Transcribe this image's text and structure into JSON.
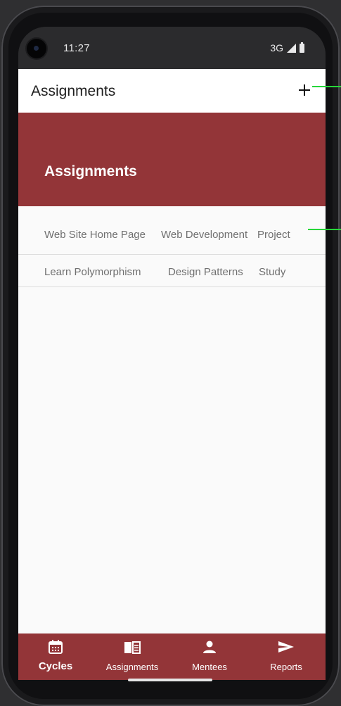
{
  "status_bar": {
    "time": "11:27",
    "network": "3G"
  },
  "top_bar": {
    "title": "Assignments",
    "add_icon": "plus-icon"
  },
  "banner": {
    "title": "Assignments"
  },
  "assignments": [
    {
      "name": "Web Site Home Page",
      "course": "Web Development",
      "type": "Project"
    },
    {
      "name": "Learn Polymorphism",
      "course": "Design Patterns",
      "type": "Study"
    }
  ],
  "bottom_nav": {
    "active": "Cycles",
    "items": [
      {
        "label": "Cycles",
        "icon": "calendar-icon"
      },
      {
        "label": "Assignments",
        "icon": "book-icon"
      },
      {
        "label": "Mentees",
        "icon": "person-icon"
      },
      {
        "label": "Reports",
        "icon": "send-icon"
      }
    ]
  },
  "colors": {
    "accent": "#933538",
    "indicator": "#27d63a"
  }
}
